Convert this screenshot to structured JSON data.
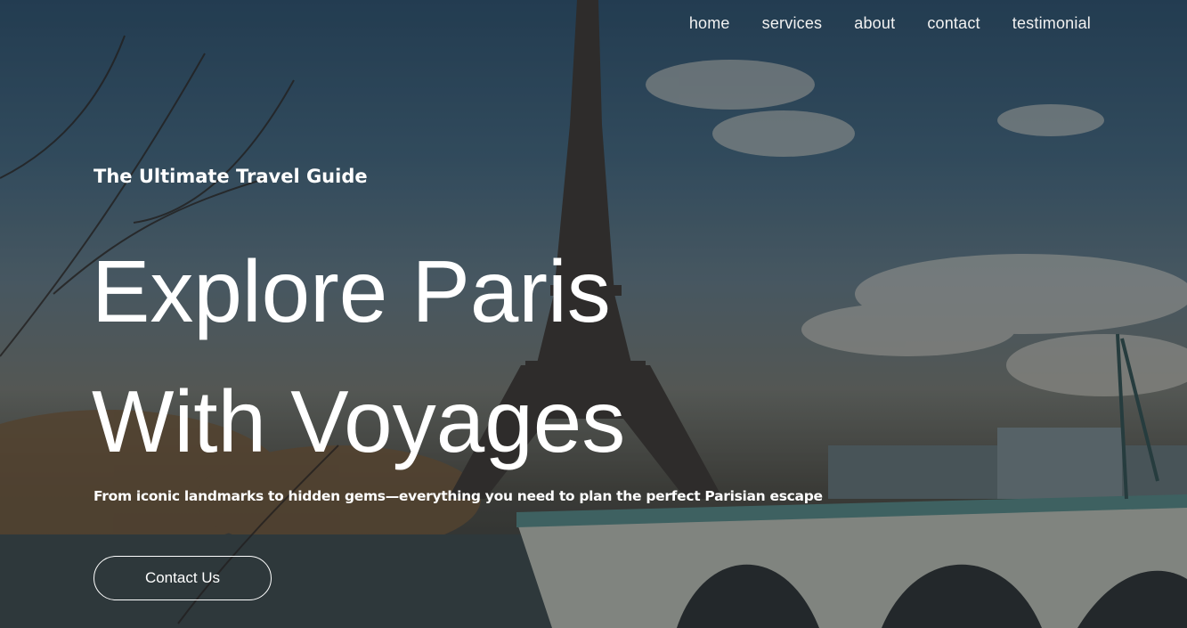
{
  "nav": {
    "items": [
      {
        "label": "home"
      },
      {
        "label": "services"
      },
      {
        "label": "about"
      },
      {
        "label": "contact"
      },
      {
        "label": "testimonial"
      }
    ]
  },
  "hero": {
    "eyebrow": "The Ultimate Travel Guide",
    "headline_line1": "Explore Paris",
    "headline_line2": "With Voyages",
    "subline": "From iconic landmarks to hidden gems—everything you need to plan the perfect Parisian escape",
    "cta_label": "Contact Us",
    "background_image": "eiffel-tower-seine-photo"
  },
  "colors": {
    "text": "#ffffff",
    "sky": "#3e5d72",
    "river": "#2f3436"
  }
}
